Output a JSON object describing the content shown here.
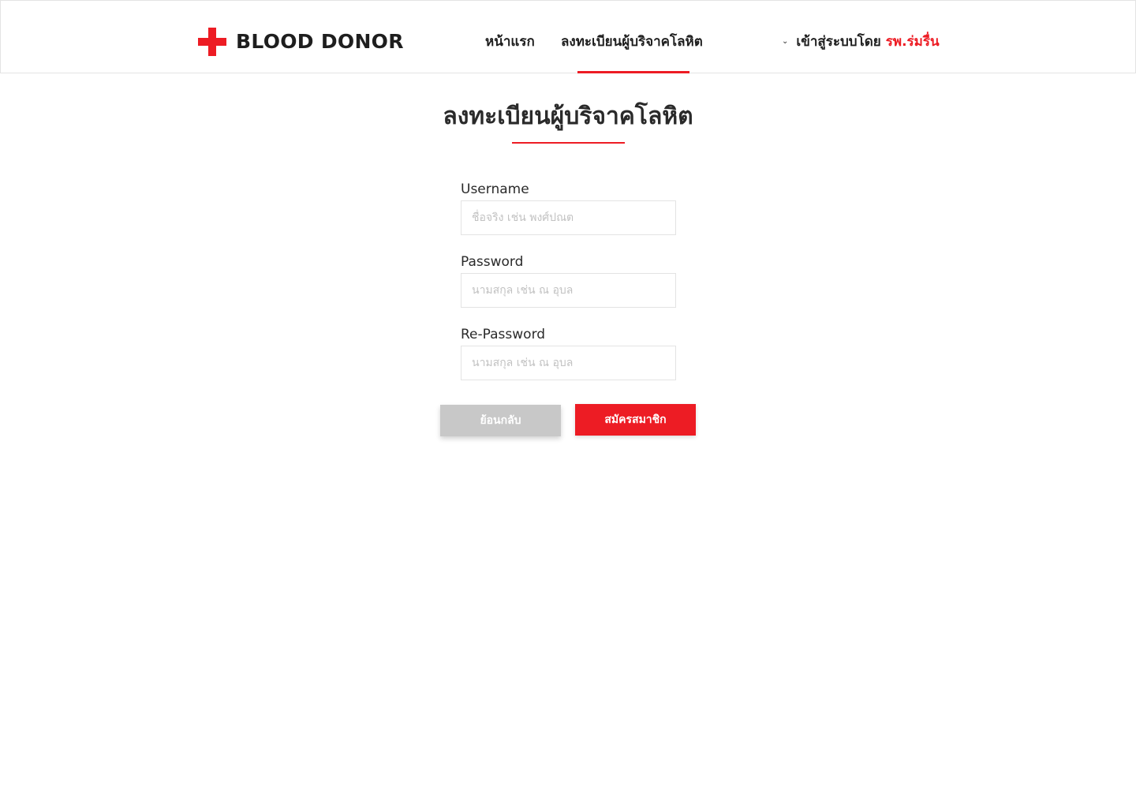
{
  "brand": {
    "name": "BLOOD DONOR",
    "accent_color": "#ed1c24"
  },
  "nav": {
    "items": [
      {
        "label": "หน้าแรก"
      },
      {
        "label": "ลงทะเบียนผู้บริจาคโลหิต",
        "active": true
      }
    ],
    "login": {
      "label": "เข้าสู่ระบบโดย",
      "hospital": "รพ.ร่มรื่น",
      "icon": "chevron-down-icon"
    }
  },
  "page": {
    "title": "ลงทะเบียนผู้บริจาคโลหิต"
  },
  "form": {
    "fields": [
      {
        "label": "Username",
        "value": "",
        "placeholder": "ชื่อจริง เช่น พงศ์ปณต"
      },
      {
        "label": "Password",
        "value": "",
        "placeholder": "นามสกุล เช่น ณ อุบล"
      },
      {
        "label": "Re-Password",
        "value": "",
        "placeholder": "นามสกุล เช่น ณ อุบล"
      }
    ],
    "buttons": {
      "back": "ย้อนกลับ",
      "submit": "สมัครสมาชิก"
    }
  }
}
